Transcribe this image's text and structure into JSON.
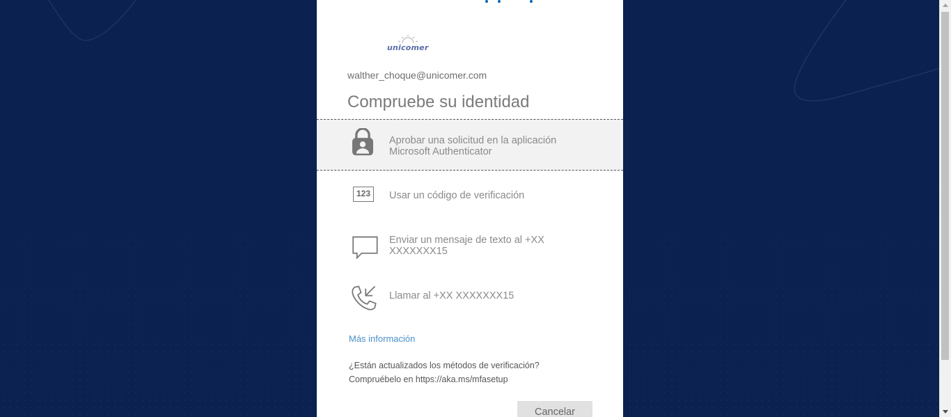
{
  "brand": {
    "logo_text": "unicomer"
  },
  "account": {
    "email": "walther_choque@unicomer.com"
  },
  "heading": "Compruebe su identidad",
  "options": [
    {
      "label": "Aprobar una solicitud en la aplicación Microsoft Authenticator",
      "icon": "authenticator-lock-icon",
      "selected": true
    },
    {
      "label": "Usar un código de verificación",
      "icon": "verification-code-icon",
      "icon_text": "123"
    },
    {
      "label": "Enviar un mensaje de texto al +XX XXXXXXX15",
      "icon": "text-message-icon"
    },
    {
      "label": "Llamar al +XX XXXXXXX15",
      "icon": "phone-call-icon"
    }
  ],
  "more_info_link": "Más información",
  "note_line1": "¿Están actualizados los métodos de verificación?",
  "note_line2": "Compruébelo en https://aka.ms/mfasetup",
  "cancel_button": "Cancelar",
  "colors": {
    "background": "#0b2150",
    "link": "#4a90c9",
    "selected_row": "#f2f2f2"
  }
}
